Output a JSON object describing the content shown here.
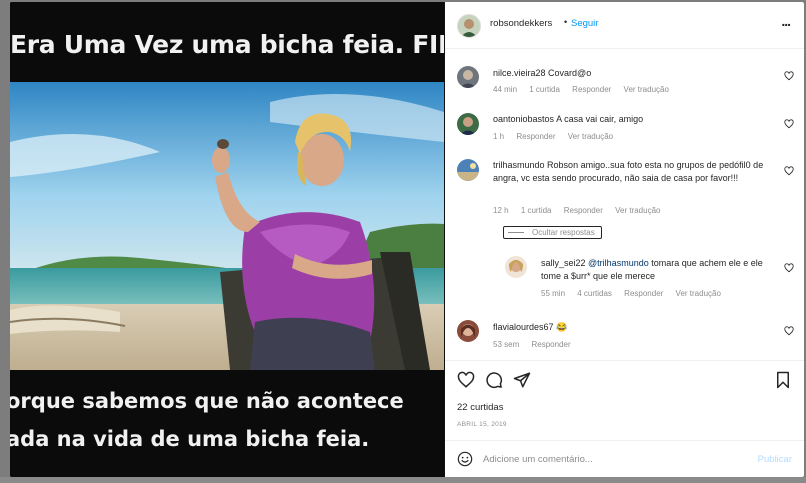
{
  "meme": {
    "top_caption": "Era Uma Vez uma bicha feia. FIM",
    "bottom_caption_1": "orque sabemos que não acontece",
    "bottom_caption_2": "ada na vida de uma bicha feia."
  },
  "post": {
    "author": "robsondekkers",
    "dot": "•",
    "follow_label": "Seguir",
    "more_label": "...",
    "likes": "22 curtidas",
    "date": "ABRIL 15, 2019"
  },
  "comments": [
    {
      "user": "nilce.vieira28",
      "text": "Covard@o",
      "time": "44 min",
      "likes": "1 curtida",
      "reply": "Responder",
      "translate": "Ver tradução"
    },
    {
      "user": "oantoniobastos",
      "text": "A casa vai cair, amigo",
      "time": "1 h",
      "reply": "Responder",
      "translate": "Ver tradução"
    },
    {
      "user": "trilhasmundo",
      "text": "Robson amigo..sua foto esta no grupos de pedófil0 de angra, vc esta sendo procurado, não saia de casa por favor!!!",
      "time": "12 h",
      "likes": "1 curtida",
      "reply": "Responder",
      "translate": "Ver tradução"
    },
    {
      "user": "flavialourdes67",
      "text": "😂",
      "time": "53 sem",
      "reply": "Responder"
    }
  ],
  "replies_toggle": "Ocultar respostas",
  "reply": {
    "user": "sally_sei22",
    "mention": "@trilhasmundo",
    "text": "tomara que achem ele e ele tome a $urr* que ele merece",
    "time": "55 min",
    "likes": "4 curtidas",
    "reply": "Responder",
    "translate": "Ver tradução"
  },
  "composer": {
    "placeholder": "Adicione um comentário...",
    "publish": "Publicar"
  },
  "colors": {
    "link": "#0095f6",
    "muted": "#8e8e8e",
    "publish_disabled": "#b3dbff"
  }
}
